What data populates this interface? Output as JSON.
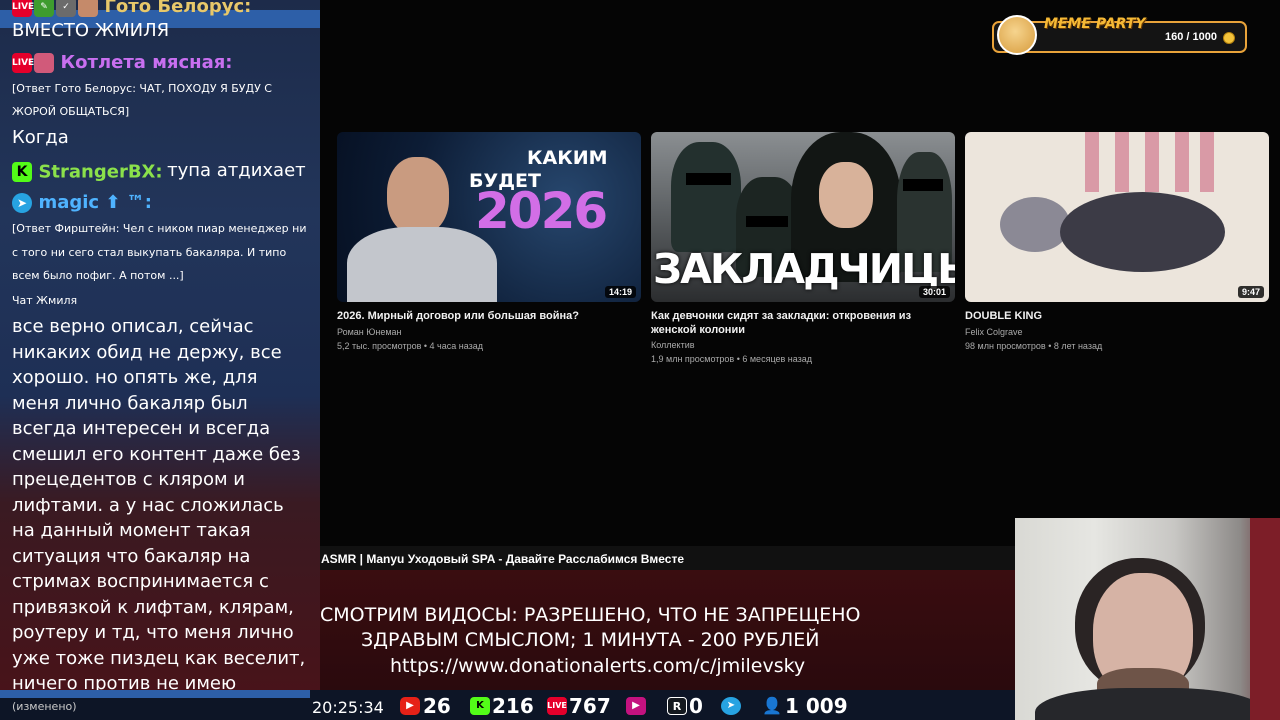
{
  "chat": {
    "msg1": {
      "nick": "Гото Белорус:",
      "text": "ВМЕСТО ЖМИЛЯ"
    },
    "msg2": {
      "nick": "Котлета мясная:",
      "reply_line1": "[Ответ Гото Белорус: ЧАТ, ПОХОДУ Я БУДУ С",
      "reply_line2": "ЖОРОЙ ОБЩАТЬСЯ]",
      "text": "Когда"
    },
    "msg3": {
      "nick": "StrangerBX:",
      "text": "тупа атдихает"
    },
    "msg4": {
      "nick": "magic ⬆ ™:",
      "reply_line1": "[Ответ Фирштейн: Чел с ником пиар менеджер ни",
      "reply_line2": "с того ни сего стал выкупать бакаляра. И типо",
      "reply_line3": "всем было пофиг. А потом ...]"
    },
    "msg5": {
      "label": "Чат Жмиля",
      "lines": [
        "все верно описал, сейчас",
        "никаких обид не держу, все",
        "хорошо. но опять же, для",
        "меня лично бакаляр был",
        "всегда интересен и всегда",
        "смешил его контент даже без",
        "прецедентов с кляром и",
        "лифтами. а у нас сложилась",
        "на данный момент такая",
        "ситуация что бакаляр на",
        "стримах воспринимается с",
        "привязкой к лифтам, клярам,",
        "роутеру и тд, что меня лично",
        "уже тоже пиздец как веселит,",
        "ничего против не имею"
      ],
      "edited": "(изменено)"
    },
    "live_badge": "LIVE"
  },
  "meme_party": {
    "title": "MEME PARTY",
    "progress": "160 / 1000",
    "progress_fraction": 0.16
  },
  "videos": [
    {
      "title": "2026. Мирный договор или большая война?",
      "channel": "Роман Юнеман",
      "meta": "5,2 тыс. просмотров • 4 часа назад",
      "duration": "14:19",
      "thumb_text1": "КАКИМ",
      "thumb_text2": "БУДЕТ",
      "thumb_text3": "2026"
    },
    {
      "title_line1": "Как девчонки сидят за закладки: откровения из",
      "title_line2": "женской колонии",
      "channel": "Коллектив",
      "meta": "1,9 млн просмотров • 6 месяцев назад",
      "duration": "30:01",
      "thumb_text": "ЗАКЛАДЧИЦЫ"
    },
    {
      "title": "DOUBLE KING",
      "channel": "Felix Colgrave",
      "meta": "98 млн просмотров • 8 лет назад",
      "duration": "9:47"
    }
  ],
  "now_playing": "ASMR | Manyu Уходовый SPA - Давайте Расслабимся Вместе",
  "donation": {
    "line1": "СМОТРИМ ВИДОСЫ: РАЗРЕШЕНО, ЧТО НЕ ЗАПРЕЩЕНО",
    "line2": "ЗДРАВЫМ СМЫСЛОМ; 1 МИНУТА - 200 РУБЛЕЙ",
    "line3": "https://www.donationalerts.com/c/jmilevsky"
  },
  "status": {
    "time": "20:25:34",
    "youtube": "26",
    "kick": "216",
    "vk": "767",
    "rutube": "0",
    "viewers": "1 009"
  },
  "colors": {
    "accent_blue": "#2d5fa8",
    "kick_green": "#53fc18",
    "live_red": "#e5002b",
    "meme_orange": "#e9a33a"
  }
}
